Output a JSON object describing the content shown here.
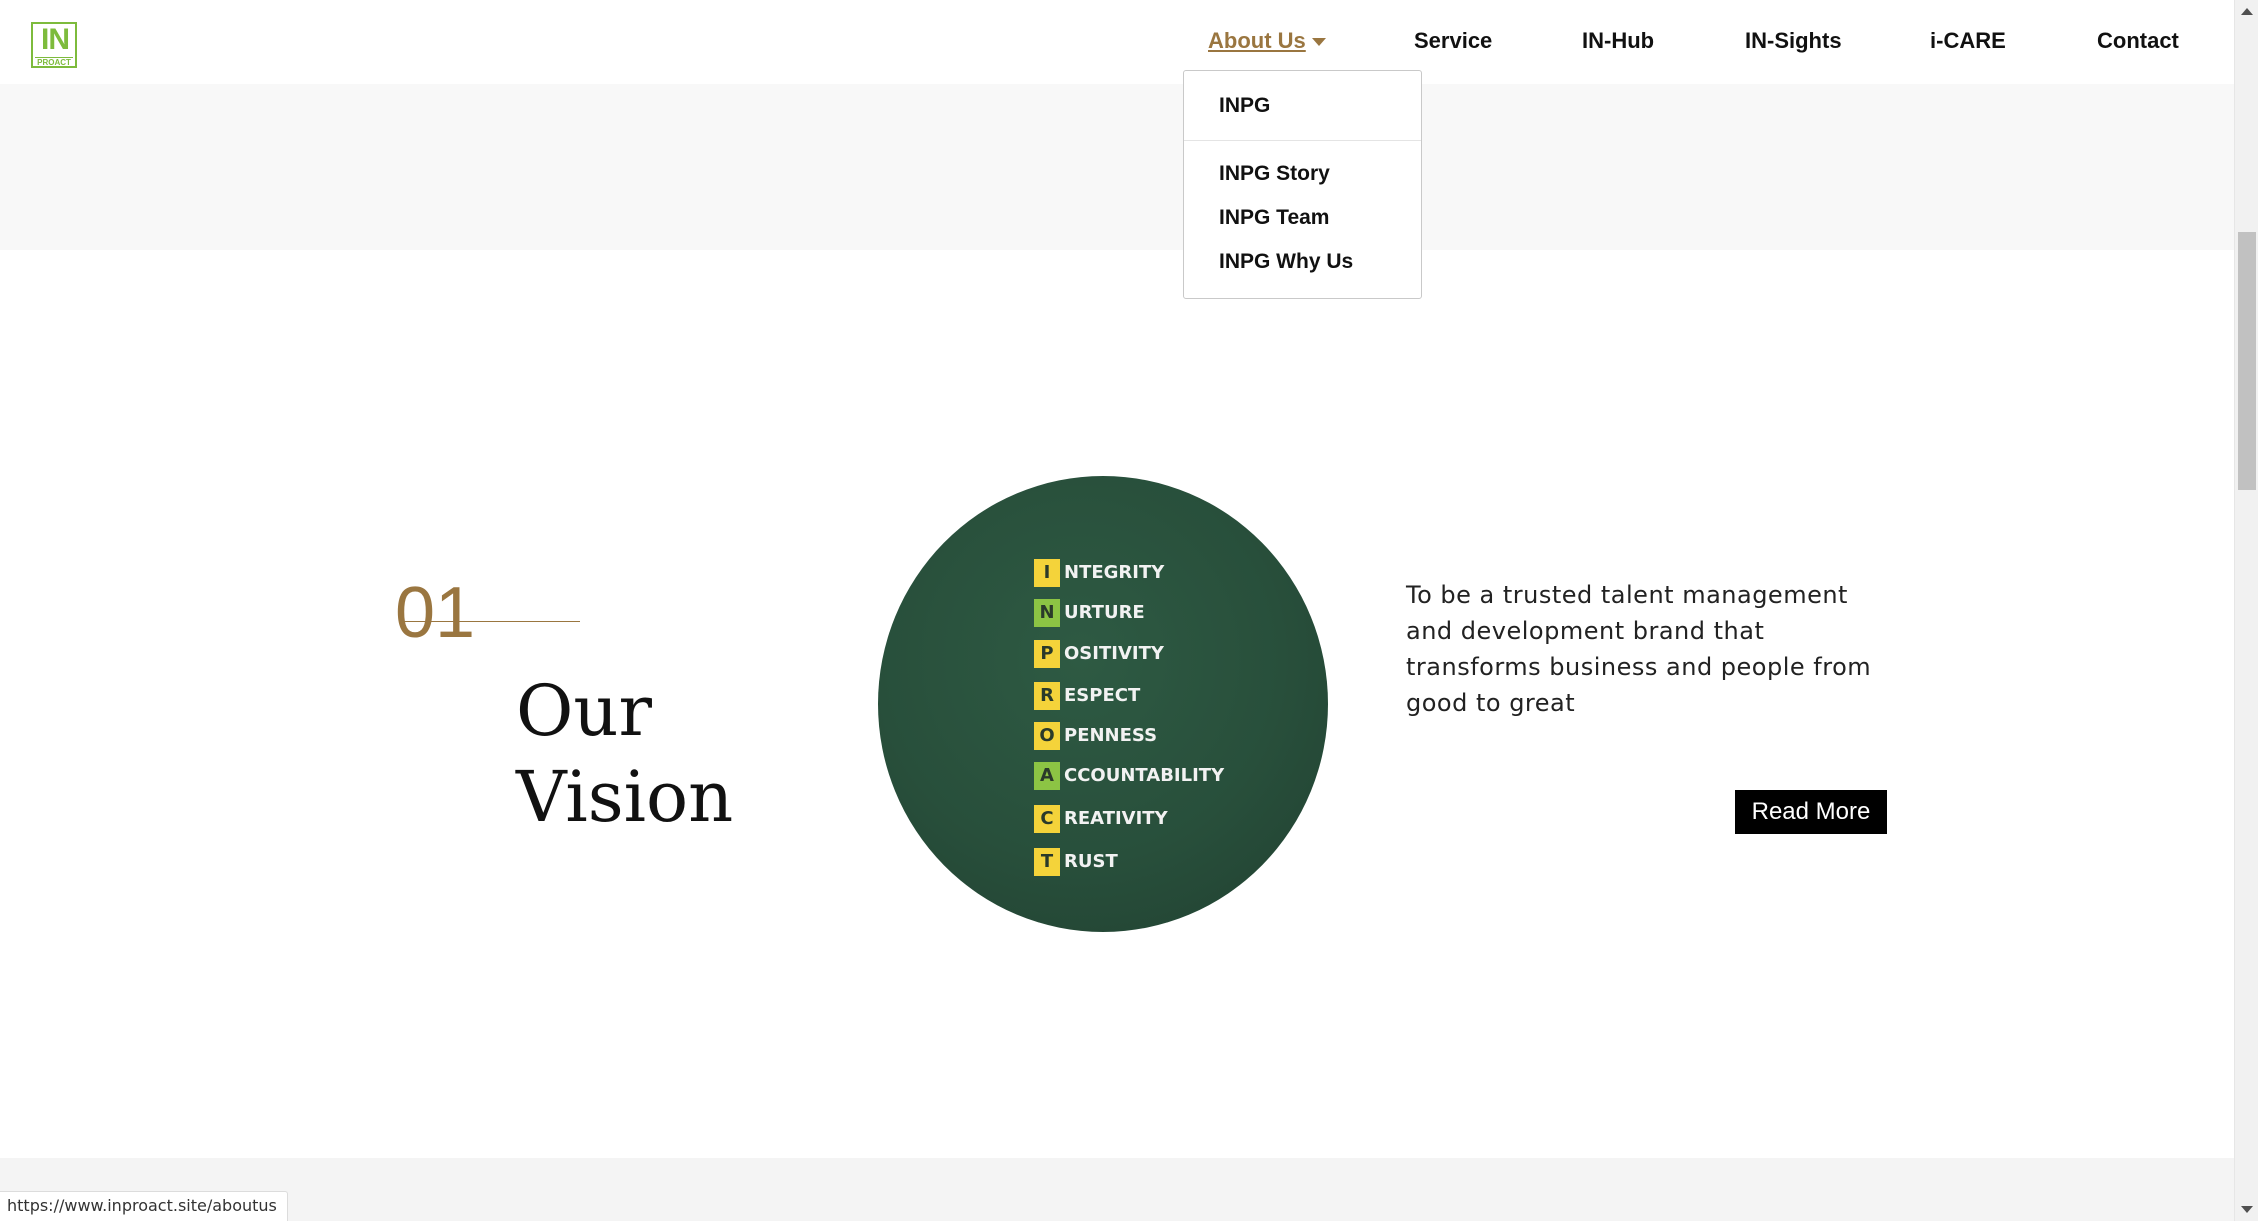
{
  "logo": {
    "big": "IN",
    "small": "PROACT"
  },
  "nav": {
    "about": "About Us",
    "service": "Service",
    "inhub": "IN-Hub",
    "insights": "IN-Sights",
    "icare": "i-CARE",
    "contact": "Contact"
  },
  "dropdown": {
    "items": [
      "INPG",
      "INPG Story",
      "INPG Team",
      "INPG Why Us"
    ]
  },
  "vision": {
    "number": "01",
    "title_line1": "Our",
    "title_line2": "Vision",
    "text": "To be a trusted talent management and development brand that transforms business and people from good to great",
    "read_more": "Read More"
  },
  "values_image": {
    "rows": [
      {
        "letter": "I",
        "rest": "NTEGRITY",
        "color": "#f4d33a"
      },
      {
        "letter": "N",
        "rest": "URTURE",
        "color": "#8cc444"
      },
      {
        "letter": "P",
        "rest": "OSITIVITY",
        "color": "#f4d33a"
      },
      {
        "letter": "R",
        "rest": "ESPECT",
        "color": "#f4d33a"
      },
      {
        "letter": "O",
        "rest": "PENNESS",
        "color": "#f4d33a"
      },
      {
        "letter": "A",
        "rest": "CCOUNTABILITY",
        "color": "#8cc444"
      },
      {
        "letter": "C",
        "rest": "REATIVITY",
        "color": "#f4d33a"
      },
      {
        "letter": "T",
        "rest": "RUST",
        "color": "#f4d33a"
      }
    ]
  },
  "status_bar": {
    "url": "https://www.inproact.site/aboutus"
  },
  "colors": {
    "accent_brown": "#9a7640",
    "logo_green": "#7dbb3c",
    "chalkboard_green": "#284f3b"
  }
}
